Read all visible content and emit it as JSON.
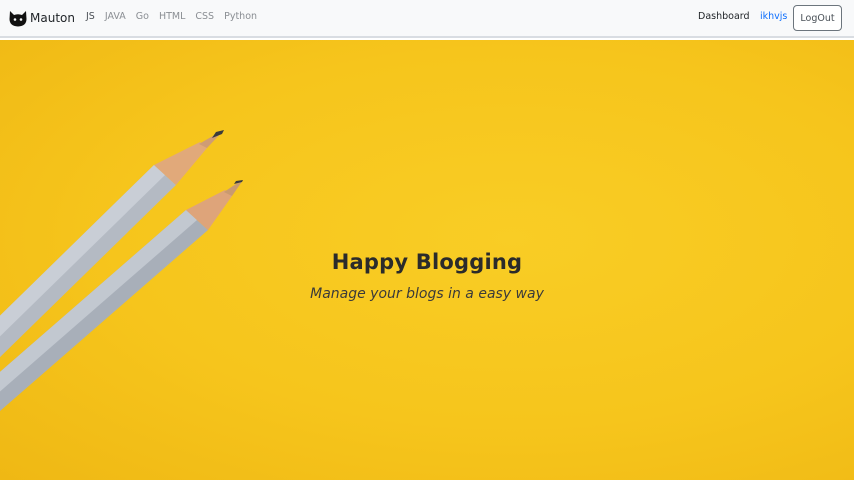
{
  "navbar": {
    "brand": {
      "name": "Mauton",
      "logo_icon": "cat-icon"
    },
    "links": [
      {
        "label": "JS",
        "active": true
      },
      {
        "label": "JAVA",
        "active": false
      },
      {
        "label": "Go",
        "active": false
      },
      {
        "label": "HTML",
        "active": false
      },
      {
        "label": "CSS",
        "active": false
      },
      {
        "label": "Python",
        "active": false
      }
    ],
    "dashboard_label": "Dashboard",
    "username": "ikhvjs",
    "logout_label": "LogOut"
  },
  "hero": {
    "title": "Happy Blogging",
    "subtitle": "Manage your blogs in a easy way",
    "background_color": "#f7c61e",
    "illustration": "pencils-icon"
  },
  "colors": {
    "link_blue": "#0d6efd",
    "navbar_bg": "#f8f9fa"
  }
}
